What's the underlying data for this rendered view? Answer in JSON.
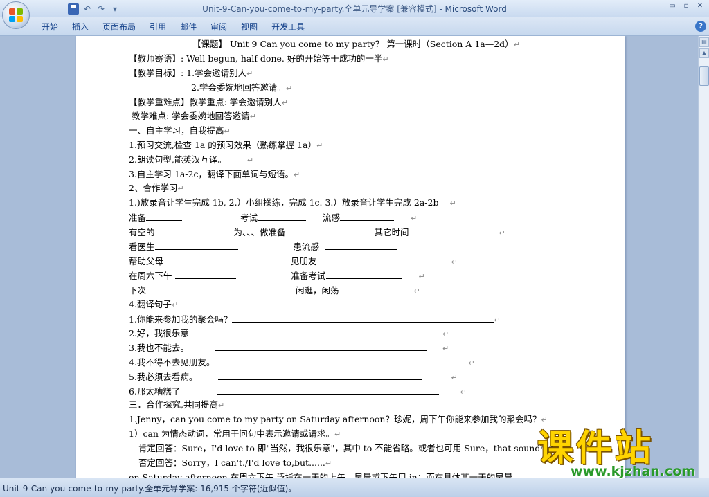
{
  "window": {
    "title_doc": "Unit-9-Can-you-come-to-my-party.全单元导学案 [兼容模式] - ",
    "title_app": "Microsoft Word",
    "minimize": "▭",
    "restore": "▫",
    "close": "✕"
  },
  "qat": {
    "undo": "↶",
    "redo": "↷",
    "more": "▾"
  },
  "ribbon": {
    "tabs": [
      "开始",
      "插入",
      "页面布局",
      "引用",
      "邮件",
      "审阅",
      "视图",
      "开发工具"
    ],
    "help": "?"
  },
  "document": {
    "l0": "【课题】  Unit 9 Can you come to my party？  第一课时（Section A 1a—2d）",
    "l1": "【教师寄语】: Well begun, half done.   好的开始等于成功的一半",
    "l2": "【教学目标】: 1.学会邀请别人",
    "l3": "2.学会委婉地回答邀请。",
    "l4": "【教学重难点】教学重点: 学会邀请别人",
    "l5": "教学难点: 学会委婉地回答邀请",
    "l6": "一、自主学习，自我提高",
    "l7": "1.预习交流,检查 1a 的预习效果（熟练掌握 1a）",
    "l8": "2.朗读句型,能英汉互译。",
    "l9": "3.自主学习 1a-2c，翻译下面单词与短语。",
    "l10": "2、合作学习",
    "l11": "1.)放录音让学生完成 1b, 2.）小组操练，完成 1c. 3.）放录音让学生完成 2a-2b",
    "v1a": "准备",
    "v1b": "考试",
    "v1c": "流感",
    "v2a": "有空的",
    "v2b": "为、、、做准备",
    "v2c": "其它时间",
    "v3a": "看医生",
    "v3b": "患流感",
    "v4a": "帮助父母",
    "v4b": "见朋友",
    "v5a": "在周六下午",
    "v5b": "准备考试",
    "v6a": "下次",
    "v6b": "闲逛，闲荡",
    "l18": "4.翻译句子",
    "s1": "1.你能来参加我的聚会吗？",
    "s2": "2.好，我很乐意",
    "s3": "3.我也不能去。",
    "s4": "4.我不得不去见朋友。",
    "s5": "5.我必须去看病。",
    "s6": "6.那太糟糕了",
    "l25": "三．合作探究,共同提高",
    "l26": "1.Jenny，can you come to my party on Saturday afternoon？珍妮，周下午你能来参加我的聚会吗？",
    "l27": "1）can 为情态动词，常用于问句中表示邀请或请求。",
    "l28": "肯定回答：Sure，I'd love to 即\"当然，我很乐意\"，其中 to 不能省略。或者也可用 Sure，that sounds good",
    "l29": "否定回答：Sorry，I can't./I'd love to,but......",
    "l30": "on Saturday afternoon   在周六下午,泛指在一天的上午、早晨或下午用 in；而在具体某一天的早晨"
  },
  "status": {
    "text": "Unit-9-Can-you-come-to-my-party.全单元导学案: 16,915 个字符(近似值)。"
  },
  "watermark": {
    "cn": "课件站",
    "url": "www.kjzhan.com"
  },
  "colors": {
    "ribbon_text": "#15428b",
    "watermark_yellow": "#ffd400",
    "watermark_green": "#2a9a2a"
  }
}
